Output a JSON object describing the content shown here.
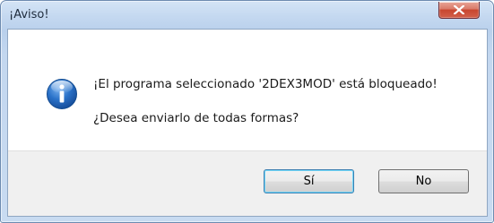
{
  "window": {
    "title": "¡Aviso!",
    "close_icon": "close-icon"
  },
  "message": {
    "icon": "info-icon",
    "line1": "¡El programa seleccionado '2DEX3MOD' está bloqueado!",
    "line2": "¿Desea enviarlo de todas formas?"
  },
  "buttons": {
    "yes_label": "Sí",
    "no_label": "No"
  },
  "colors": {
    "title_frame": "#c4d8f0",
    "close_button": "#c8462f",
    "info_icon": "#1f63b5",
    "footer": "#f0f0f0"
  }
}
